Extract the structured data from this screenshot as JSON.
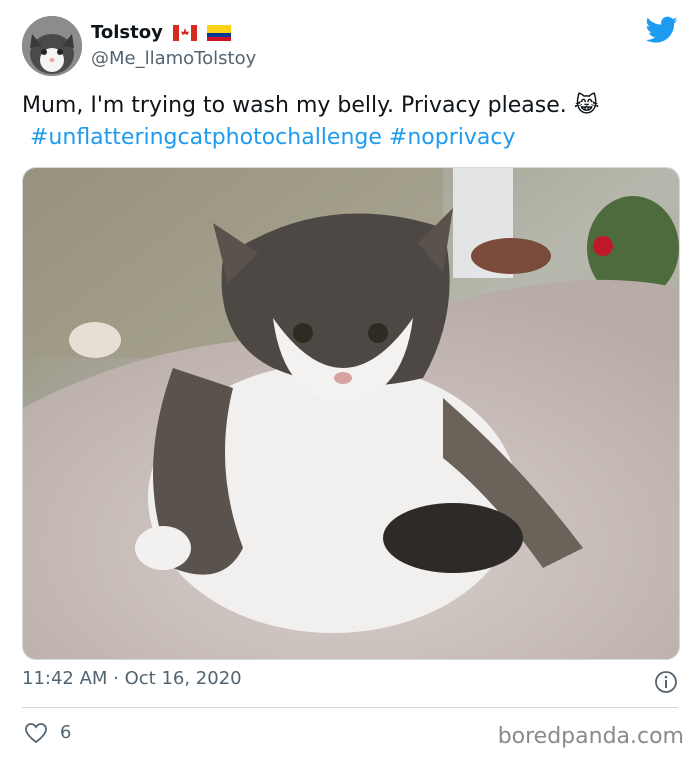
{
  "author": {
    "name": "Tolstoy",
    "handle": "@Me_llamoTolstoy",
    "flags": [
      "canada-flag-icon",
      "colombia-flag-icon"
    ]
  },
  "tweet": {
    "text": "Mum, I'm trying to wash my belly. Privacy please.",
    "emoji": "😹",
    "hashtags": "#unflatteringcatphotochallenge #noprivacy"
  },
  "photo": {
    "alt_icon": "cat-on-fluffy-blanket-photo"
  },
  "meta": {
    "timestamp": "11:42 AM · Oct 16, 2020"
  },
  "engagement": {
    "likes": "6"
  },
  "watermark": "boredpanda.com",
  "colors": {
    "link": "#1d9bf0",
    "twitter_blue": "#1d9bf0",
    "muted": "#536471",
    "divider": "#cfd9de"
  }
}
